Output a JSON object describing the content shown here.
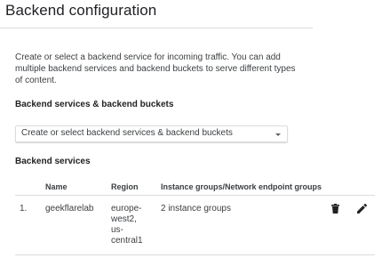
{
  "header": {
    "title": "Backend configuration"
  },
  "description": "Create or select a backend service for incoming traffic. You can add multiple backend services and backend buckets to serve different types of content.",
  "backend_selector": {
    "label": "Backend services & backend buckets",
    "value": "Create or select backend services & backend buckets"
  },
  "backend_services": {
    "label": "Backend services",
    "columns": {
      "name": "Name",
      "region": "Region",
      "groups": "Instance groups/Network endpoint groups"
    },
    "rows": [
      {
        "index": "1.",
        "name": "geekflarelab",
        "region": "europe-\nwest2,\nus-\ncentral1",
        "groups": "2 instance groups",
        "actions": [
          "trash-icon",
          "pencil-icon"
        ]
      }
    ]
  },
  "colors": {
    "text": "#202124",
    "secondary_text": "#3c4043",
    "divider": "#dadce0"
  }
}
